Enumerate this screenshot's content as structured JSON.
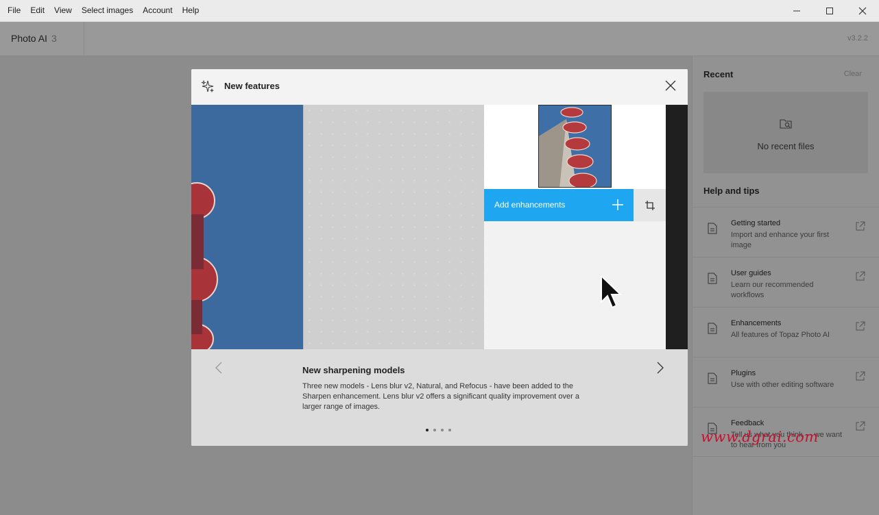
{
  "menu": [
    "File",
    "Edit",
    "View",
    "Select images",
    "Account",
    "Help"
  ],
  "app": {
    "title": "Photo AI",
    "number": "3",
    "version": "v3.2.2"
  },
  "right_panel": {
    "recent_heading": "Recent",
    "clear_label": "Clear",
    "no_recent": "No recent files",
    "help_heading": "Help and tips",
    "tips": [
      {
        "title": "Getting started",
        "desc": "Import and enhance your first image"
      },
      {
        "title": "User guides",
        "desc": "Learn our recommended workflows"
      },
      {
        "title": "Enhancements",
        "desc": "All features of Topaz Photo AI"
      },
      {
        "title": "Plugins",
        "desc": "Use with other editing software"
      },
      {
        "title": "Feedback",
        "desc": "Tell us what you think — we want to hear from you"
      }
    ]
  },
  "modal": {
    "title": "New features",
    "add_enhancements": "Add enhancements",
    "feature_title": "New sharpening models",
    "feature_desc": "Three new models - Lens blur v2, Natural, and Refocus - have been added to the Sharpen enhancement. Lens blur v2 offers a significant quality improvement over a larger range of images.",
    "page_count": 4,
    "active_page": 1
  },
  "watermark": "www.dgrai.com",
  "colors": {
    "accent": "#1ea7f0",
    "watermark": "#c8102e"
  }
}
